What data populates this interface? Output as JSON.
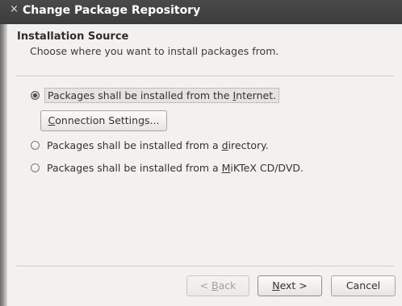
{
  "window": {
    "title": "Change Package Repository",
    "close_glyph": "×"
  },
  "header": {
    "title": "Installation Source",
    "subtitle": "Choose where you want to install packages from."
  },
  "options": [
    {
      "label_before": "Packages shall be installed from the ",
      "mnemonic": "I",
      "label_after": "nternet.",
      "selected": true
    },
    {
      "label_before": "Packages shall be installed from a ",
      "mnemonic": "d",
      "label_after": "irectory.",
      "selected": false
    },
    {
      "label_before": "Packages shall be installed from a ",
      "mnemonic": "M",
      "label_after": "iKTeX CD/DVD.",
      "selected": false
    }
  ],
  "connection_settings": {
    "mnemonic": "C",
    "label_rest": "onnection Settings..."
  },
  "footer": {
    "back": {
      "prefix": "< ",
      "mnemonic": "B",
      "rest": "ack"
    },
    "next": {
      "mnemonic": "N",
      "rest": "ext >"
    },
    "cancel": "Cancel"
  }
}
